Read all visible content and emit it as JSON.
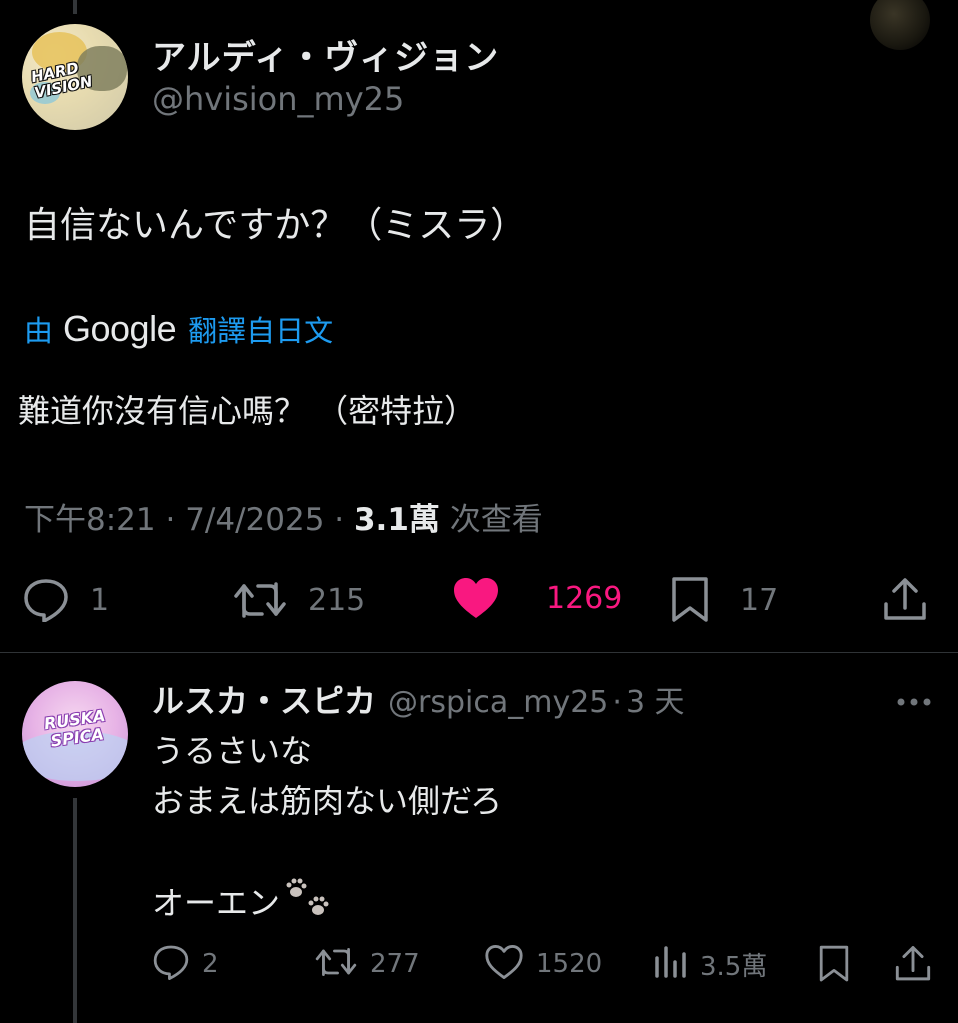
{
  "tweet": {
    "author": {
      "display_name": "アルディ・ヴィジョン",
      "handle": "@hvision_my25",
      "avatar_label": "HARD VISION"
    },
    "text": "自信ないんですか？（ミスラ）",
    "translation": {
      "prefix": "由",
      "provider": "Google",
      "suffix": "翻譯自日文",
      "text": "難道你沒有信心嗎？ （密特拉）"
    },
    "meta": {
      "time": "下午8:21",
      "date": "7/4/2025",
      "views_count": "3.1萬",
      "views_label": "次查看"
    },
    "actions": {
      "replies": "1",
      "retweets": "215",
      "likes": "1269",
      "bookmarks": "17"
    },
    "colors": {
      "like_active": "#f91880",
      "link_blue": "#1d9bf0",
      "muted": "#71767b"
    }
  },
  "reply": {
    "author": {
      "display_name": "ルスカ・スピカ",
      "handle": "@rspica_my25",
      "time_ago": "3 天",
      "avatar_label": "RUSKA SPICA"
    },
    "lines": [
      "うるさいな",
      "おまえは筋肉ない側だろ",
      "",
      "オーエン"
    ],
    "emoji": "paw-prints",
    "actions": {
      "replies": "2",
      "retweets": "277",
      "likes": "1520",
      "views": "3.5萬"
    }
  }
}
